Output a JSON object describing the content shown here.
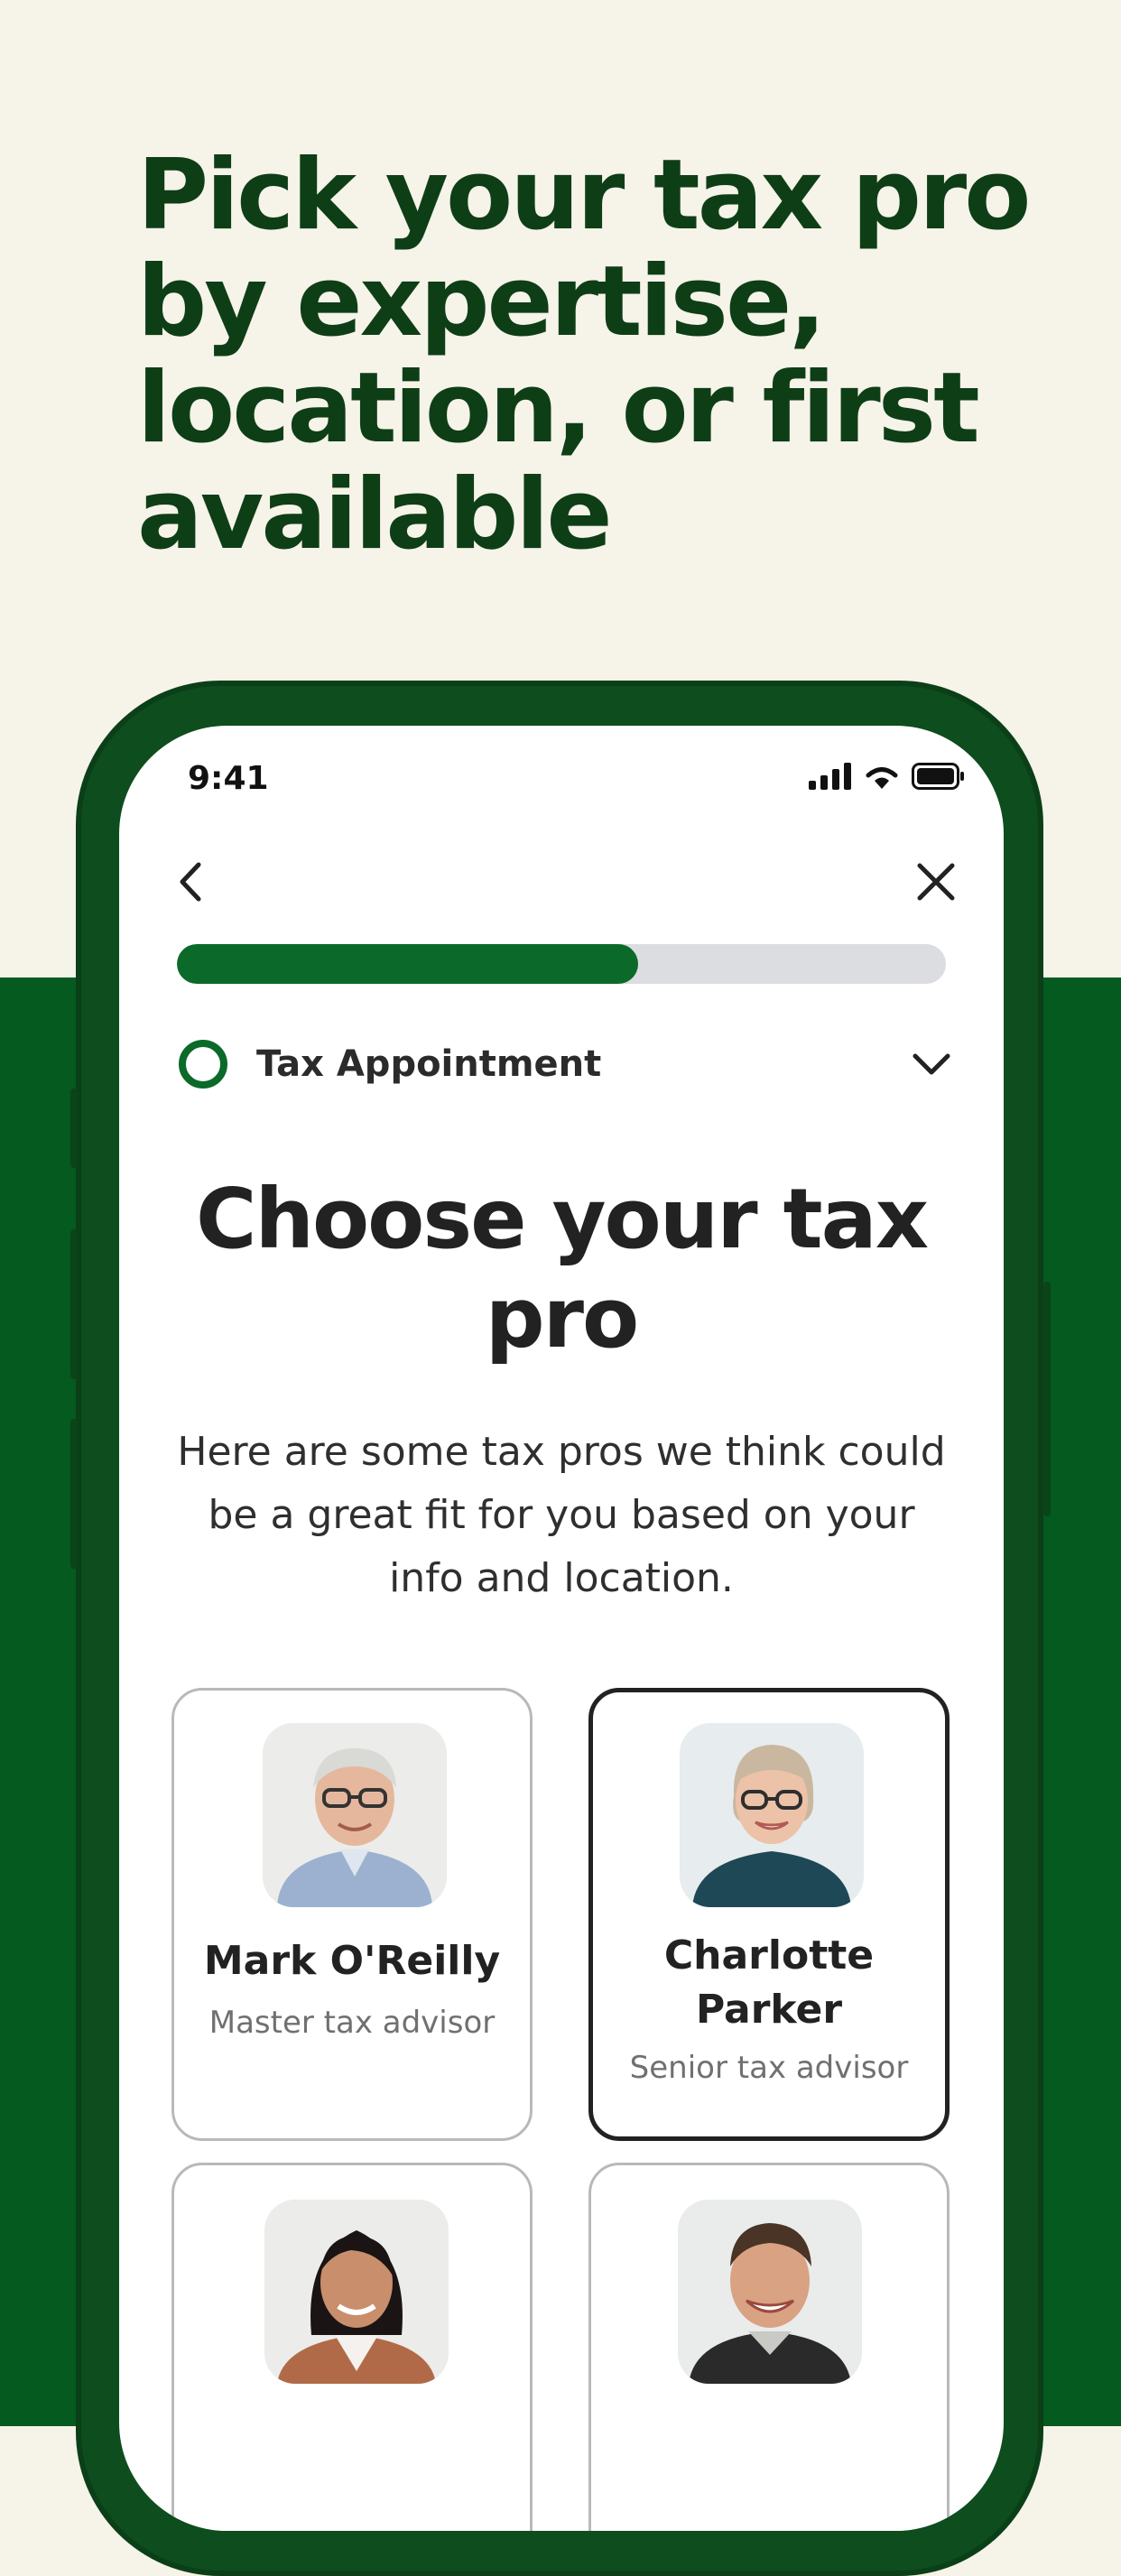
{
  "headline": "Pick your tax pro by expertise, location, or first available",
  "status_bar": {
    "time": "9:41",
    "icons": [
      "signal-icon",
      "wifi-icon",
      "battery-icon"
    ]
  },
  "nav": {
    "back_icon": "chevron-left-icon",
    "close_icon": "close-icon"
  },
  "progress": {
    "fraction": 0.6
  },
  "step": {
    "label": "Tax Appointment",
    "expand_icon": "chevron-down-icon"
  },
  "screen": {
    "title": "Choose your tax pro",
    "intro": "Here are some tax pros we think could be a great fit for you based on your info and location."
  },
  "tax_pros": [
    {
      "name": "Mark O'Reilly",
      "role": "Master tax advisor",
      "selected": false
    },
    {
      "name": "Charlotte Parker",
      "role": "Senior tax advisor",
      "selected": true
    },
    {
      "name": "",
      "role": "",
      "selected": false
    },
    {
      "name": "",
      "role": "",
      "selected": false
    }
  ],
  "colors": {
    "background": "#f6f3e8",
    "brand_green": "#045a1f",
    "headline": "#0e3e16",
    "progress_fill": "#0b6a2a",
    "progress_track": "#dcdde1"
  }
}
